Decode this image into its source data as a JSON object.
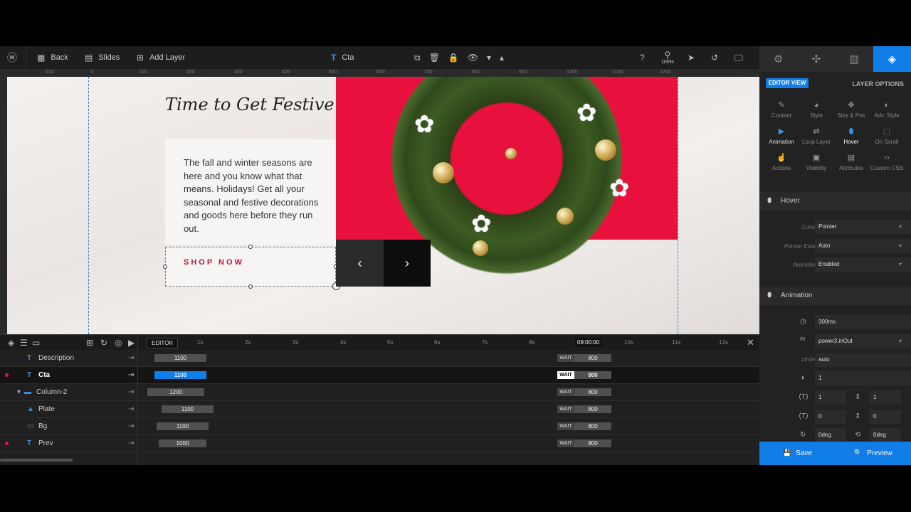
{
  "toolbar": {
    "back": "Back",
    "slides": "Slides",
    "add_layer": "Add Layer",
    "layer_name": "Cta",
    "zoom": "100%"
  },
  "ruler": [
    "-100",
    "0",
    "100",
    "200",
    "300",
    "400",
    "500",
    "600",
    "700",
    "800",
    "900",
    "1000",
    "1100",
    "1200"
  ],
  "canvas": {
    "heading": "Time to Get Festive",
    "description": "The fall and winter seasons are here and you know what that means. Holidays! Get all your seasonal and festive decorations and goods here before they run out.",
    "cta": "SHOP NOW",
    "prev_arrow": "‹",
    "next_arrow": "›"
  },
  "timeline": {
    "editor_label": "EDITOR",
    "ticks": [
      "1s",
      "2s",
      "3s",
      "4s",
      "5s",
      "6s",
      "7s",
      "8s",
      "09:00:00",
      "10s",
      "11s",
      "12s"
    ],
    "rows": [
      {
        "name": "Description",
        "bar": "1100",
        "wait": "WAIT",
        "wait_val": "800"
      },
      {
        "name": "Cta",
        "bar": "1100",
        "wait": "WAIT",
        "wait_val": "800"
      },
      {
        "name": "Column-2",
        "bar": "1200",
        "wait": "WAIT",
        "wait_val": "800"
      },
      {
        "name": "Plate",
        "bar": "1100",
        "wait": "WAIT",
        "wait_val": "800"
      },
      {
        "name": "Bg",
        "bar": "1100",
        "wait": "WAIT",
        "wait_val": "800"
      },
      {
        "name": "Prev",
        "bar": "1000",
        "wait": "WAIT",
        "wait_val": "800"
      }
    ]
  },
  "panel": {
    "editor_view": "EDITOR VIEW",
    "layer_options": "LAYER OPTIONS",
    "options": [
      "Content",
      "Style",
      "Size & Pos",
      "Adv. Style",
      "Animation",
      "Loop Layer",
      "Hover",
      "On Scroll",
      "Actions",
      "Visibility",
      "Attributes",
      "Custom CSS"
    ],
    "hover_section": "Hover",
    "cursor_label": "Cursor",
    "cursor_value": "Pointer",
    "pointer_event_label": "Pointer Event",
    "pointer_event_value": "Auto",
    "animation_label": "Animation",
    "animation_value": "Enabled",
    "animation_section": "Animation",
    "duration": "300ms",
    "easing": "power3.inOut",
    "zindex_label": "zIndex",
    "zindex": "auto",
    "opacity": "1",
    "scale_x": "1",
    "scale_y": "1",
    "skew_x": "0",
    "skew_y": "0",
    "rotate_x": "0deg",
    "rotate_y": "0deg"
  },
  "footer": {
    "save": "Save",
    "preview": "Preview"
  }
}
